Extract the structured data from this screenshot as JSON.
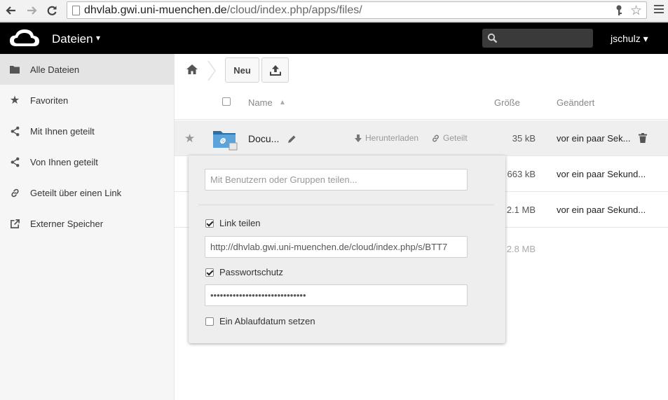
{
  "browser": {
    "url_host": "dhvlab.gwi.uni-muenchen.de",
    "url_path": "/cloud/index.php/apps/files/"
  },
  "header": {
    "app_name": "Dateien",
    "app_caret": "▾",
    "search_placeholder": "",
    "user": "jschulz ▾"
  },
  "sidebar": {
    "items": [
      {
        "label": "Alle Dateien",
        "icon": "folder-icon"
      },
      {
        "label": "Favoriten",
        "icon": "star-icon"
      },
      {
        "label": "Mit Ihnen geteilt",
        "icon": "share-icon"
      },
      {
        "label": "Von Ihnen geteilt",
        "icon": "share-icon"
      },
      {
        "label": "Geteilt über einen Link",
        "icon": "link-icon"
      },
      {
        "label": "Externer Speicher",
        "icon": "external-link-icon"
      }
    ]
  },
  "controls": {
    "new_label": "Neu"
  },
  "table": {
    "col_name": "Name",
    "sort_indicator": "▲",
    "col_size": "Größe",
    "col_modified": "Geändert",
    "rows": [
      {
        "name": "Docu...",
        "size": "35 kB",
        "modified": "vor ein paar Sek..."
      },
      {
        "name": "",
        "size": "663 kB",
        "modified": "vor ein paar Sekund..."
      },
      {
        "name": "",
        "size": "2.1 MB",
        "modified": "vor ein paar Sekund..."
      },
      {
        "name": "",
        "size": "2.8 MB",
        "modified": ""
      }
    ],
    "actions": {
      "download": "Herunterladen",
      "shared": "Geteilt"
    }
  },
  "share_dropdown": {
    "share_with_placeholder": "Mit Benutzern oder Gruppen teilen...",
    "link_share_label": "Link teilen",
    "link_share_checked": true,
    "link_url": "http://dhvlab.gwi.uni-muenchen.de/cloud/index.php/s/BTT7",
    "password_label": "Passwortschutz",
    "password_checked": true,
    "password_value": "••••••••••••••••••••••••••••••",
    "expire_label": "Ein Ablaufdatum setzen",
    "expire_checked": false
  },
  "colors": {
    "header_bg": "#000000",
    "sidebar_bg": "#f6f6f6",
    "sidebar_active": "#e4e4e4",
    "row_highlight": "#efefef",
    "dropdown_bg": "#eeeeee"
  }
}
